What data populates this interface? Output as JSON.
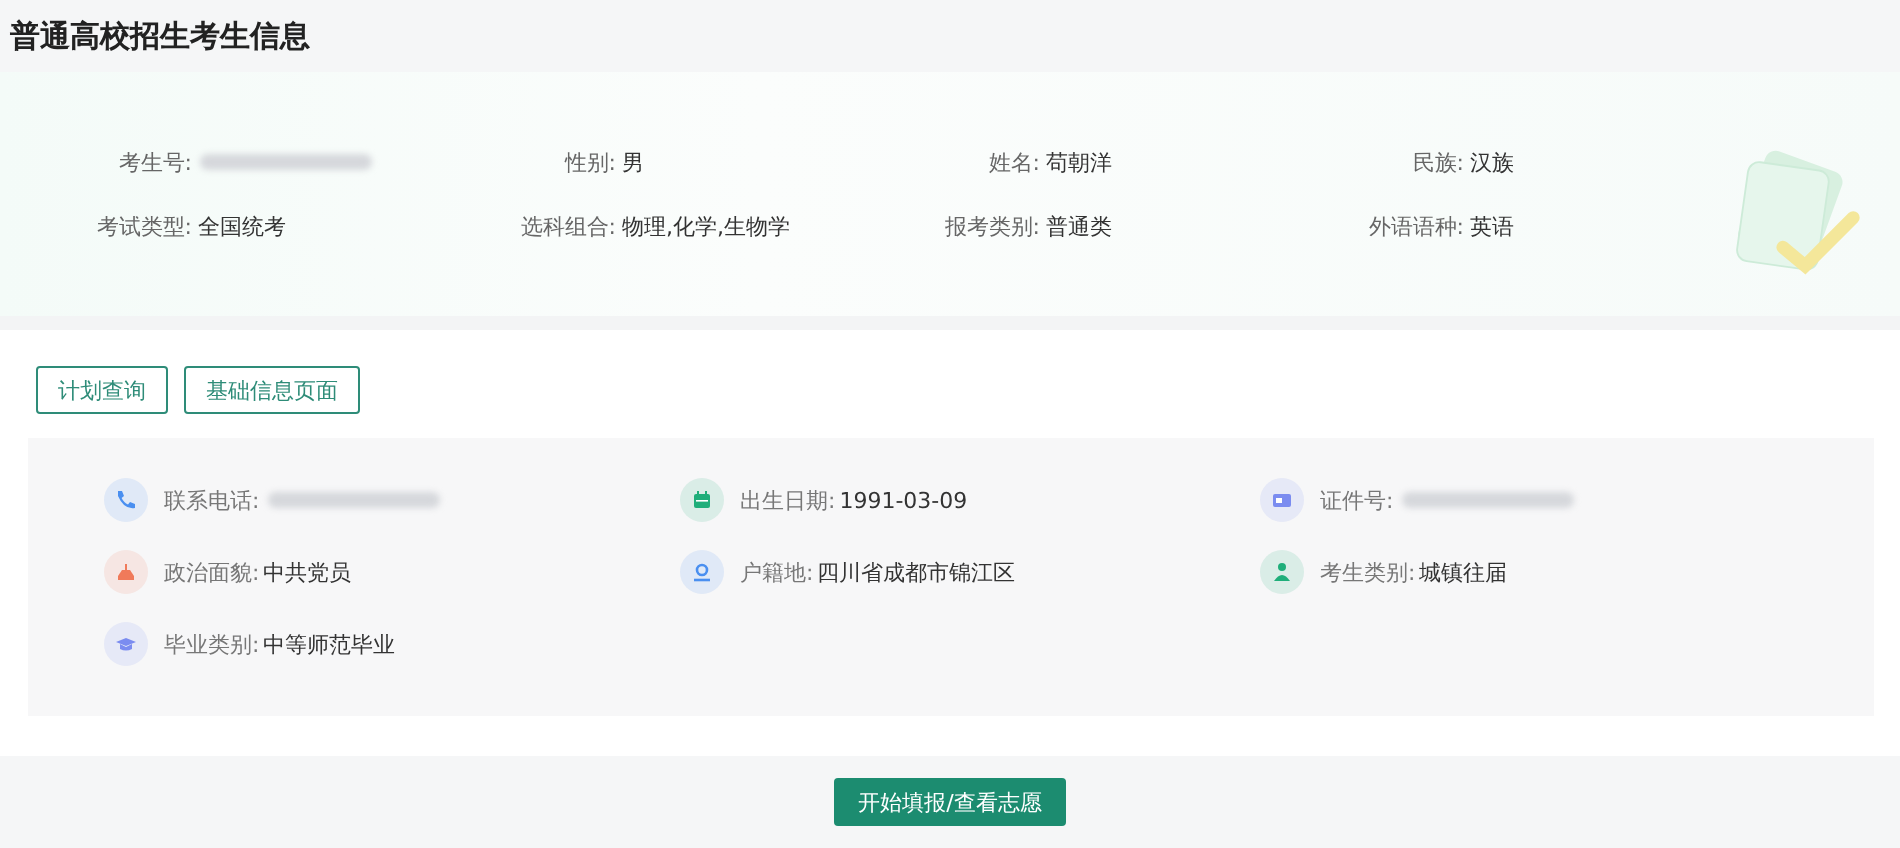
{
  "title": "普通高校招生考生信息",
  "summary": [
    {
      "label": "考生号:",
      "redacted": true
    },
    {
      "label": "性别:",
      "value": "男",
      "redacted": false
    },
    {
      "label": "姓名:",
      "value": "苟朝洋",
      "redacted": false
    },
    {
      "label": "民族:",
      "value": "汉族",
      "redacted": false
    },
    {
      "label": "考试类型:",
      "value": "全国统考",
      "redacted": false
    },
    {
      "label": "选科组合:",
      "value": "物理,化学,生物学",
      "redacted": false
    },
    {
      "label": "报考类别:",
      "value": "普通类",
      "redacted": false
    },
    {
      "label": "外语语种:",
      "value": "英语",
      "redacted": false
    }
  ],
  "buttons": [
    "计划查询",
    "基础信息页面"
  ],
  "details": [
    {
      "kind": "phone",
      "color": "#4a8ff0",
      "label": "联系电话:",
      "redacted": true
    },
    {
      "kind": "calendar",
      "color": "#1fae7a",
      "label": "出生日期:",
      "value": "1991-03-09",
      "redacted": false
    },
    {
      "kind": "card",
      "color": "#7b8cf0",
      "label": "证件号:",
      "redacted": true
    },
    {
      "kind": "flag",
      "color": "#f07a5a",
      "label": "政治面貌:",
      "value": "中共党员",
      "redacted": false
    },
    {
      "kind": "location",
      "color": "#4a8ff0",
      "label": "户籍地:",
      "value": "四川省成都市锦江区",
      "redacted": false
    },
    {
      "kind": "person",
      "color": "#1fae7a",
      "label": "考生类别:",
      "value": "城镇往届",
      "redacted": false
    },
    {
      "kind": "cap",
      "color": "#7b8cf0",
      "label": "毕业类别:",
      "value": "中等师范毕业",
      "redacted": false
    }
  ],
  "primary_button": "开始填报/查看志愿"
}
